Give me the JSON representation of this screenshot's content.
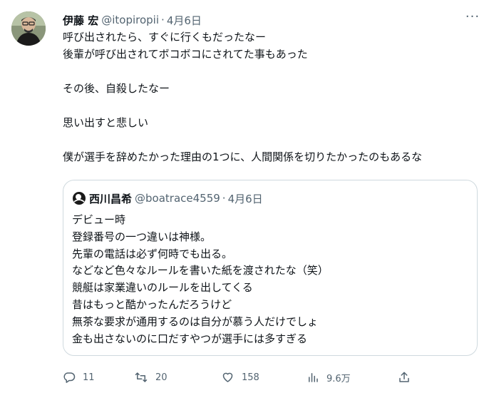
{
  "tweet": {
    "author_name": "伊藤 宏",
    "handle": "@itopiropii",
    "separator": "·",
    "date": "4月6日",
    "more_label": "···",
    "lines": [
      "呼び出されたら、すぐに行くもだったなー",
      "後輩が呼び出されてボコボコにされてた事もあった",
      "",
      "その後、自殺したなー",
      "",
      "思い出すと悲しい",
      "",
      "僕が選手を辞めたかった理由の1つに、人間関係を切りたかったのもあるな"
    ]
  },
  "quote": {
    "author_name": "西川昌希",
    "handle": "@boatrace4559",
    "separator": "·",
    "date": "4月6日",
    "lines": [
      "デビュー時",
      "登録番号の一つ違いは神様。",
      "先輩の電話は必ず何時でも出る。",
      "などなど色々なルールを書いた紙を渡されたな（笑）",
      "競艇は家業違いのルールを出してくる",
      "昔はもっと酷かったんだろうけど",
      "無茶な要求が通用するのは自分が慕う人だけでしょ",
      "金も出さないのに口だすやつが選手には多すぎる"
    ]
  },
  "actions": {
    "reply_count": "11",
    "retweet_count": "20",
    "like_count": "158",
    "views_count": "9.6万"
  },
  "icons": {
    "reply": "reply-icon",
    "retweet": "retweet-icon",
    "like": "heart-icon",
    "views": "views-chart-icon",
    "share": "share-icon",
    "more": "more-icon"
  },
  "colors": {
    "text": "#0f1419",
    "secondary": "#536471",
    "border": "#cfd9de"
  }
}
